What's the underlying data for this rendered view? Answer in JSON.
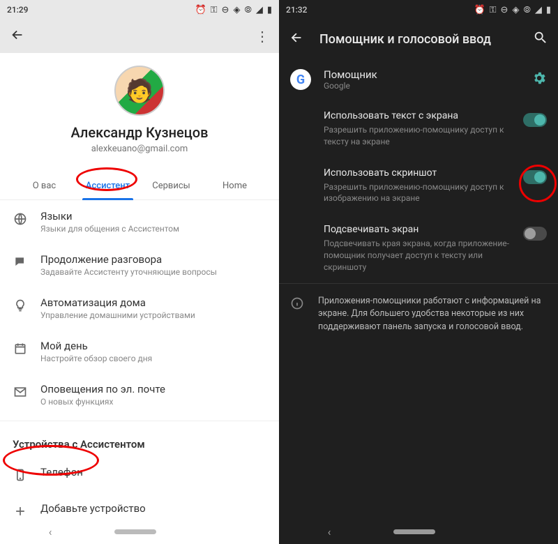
{
  "light": {
    "time": "21:29",
    "profile": {
      "name": "Александр Кузнецов",
      "email": "alexkeuano@gmail.com"
    },
    "tabs": [
      {
        "label": "О вас"
      },
      {
        "label": "Ассистент"
      },
      {
        "label": "Сервисы"
      },
      {
        "label": "Home"
      }
    ],
    "activeTab": 1,
    "items": [
      {
        "icon": "globe",
        "title": "Языки",
        "sub": "Языки для общения с Ассистентом"
      },
      {
        "icon": "chat",
        "title": "Продолжение разговора",
        "sub": "Задавайте Ассистенту уточняющие вопросы"
      },
      {
        "icon": "bulb",
        "title": "Автоматизация дома",
        "sub": "Управление домашними устройствами"
      },
      {
        "icon": "calendar",
        "title": "Мой день",
        "sub": "Настройте обзор своего дня"
      },
      {
        "icon": "mail",
        "title": "Оповещения по эл. почте",
        "sub": "О новых функциях"
      }
    ],
    "devicesSection": "Устройства с Ассистентом",
    "devices": [
      {
        "icon": "phone",
        "title": "Телефон"
      },
      {
        "icon": "plus",
        "title": "Добавьте устройство"
      }
    ]
  },
  "dark": {
    "time": "21:32",
    "title": "Помощник и голосовой ввод",
    "assistant": {
      "title": "Помощник",
      "sub": "Google"
    },
    "settings": [
      {
        "title": "Использовать текст с экрана",
        "sub": "Разрешить приложению-помощнику доступ к тексту на экране",
        "on": true
      },
      {
        "title": "Использовать скриншот",
        "sub": "Разрешить приложению-помощнику доступ к изображению на экране",
        "on": true
      },
      {
        "title": "Подсвечивать экран",
        "sub": "Подсвечивать края экрана, когда приложение-помощник получает доступ к тексту или скриншоту",
        "on": false
      }
    ],
    "infoText": "Приложения-помощники работают с информацией на экране. Для большего удобства некоторые из них поддерживают панель запуска и голосовой ввод."
  }
}
